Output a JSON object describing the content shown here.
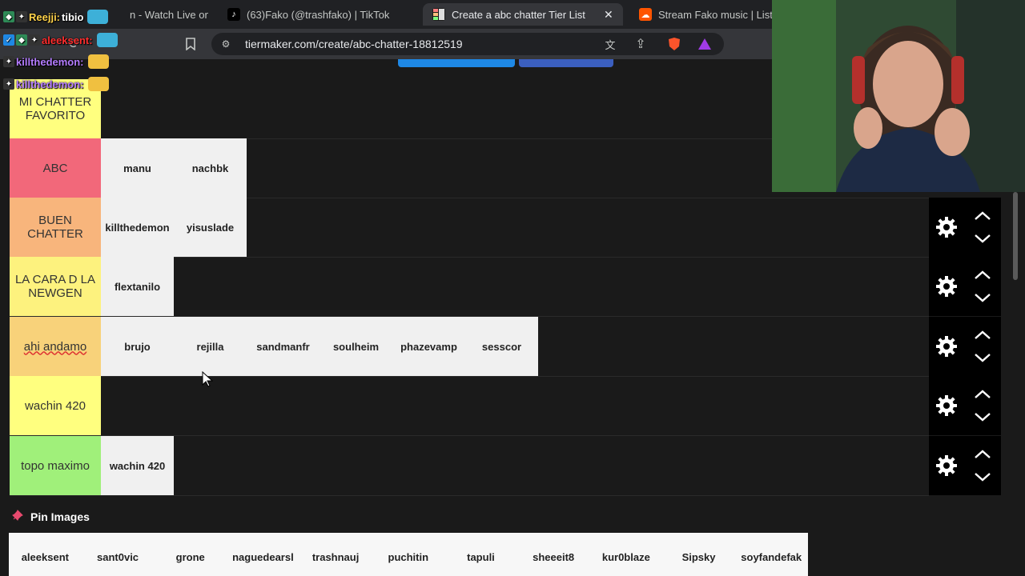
{
  "browser": {
    "tabs": [
      {
        "title": "n - Watch Live on",
        "icon": "twitch-icon"
      },
      {
        "title": "(63)Fako (@trashfako) | TikTok",
        "icon": "tiktok-icon"
      },
      {
        "title": "Create a abc chatter Tier List",
        "icon": "tiermaker-icon",
        "active": true
      },
      {
        "title": "Stream Fako music | List",
        "icon": "soundcloud-icon"
      }
    ],
    "url": "tiermaker.com/create/abc-chatter-18812519",
    "shields_count": "5"
  },
  "tiers": [
    {
      "label": "MI CHATTER FAVORITO",
      "color": "#ffff7f",
      "items": []
    },
    {
      "label": "ABC",
      "color": "#f2687a",
      "items": [
        "manu",
        "nachbk"
      ]
    },
    {
      "label": "BUEN CHATTER",
      "color": "#f8b57c",
      "items": [
        "killthedemon",
        "yisuslade"
      ]
    },
    {
      "label": "LA CARA D LA NEWGEN",
      "color": "#fdf27e",
      "items": [
        "flextanilo"
      ]
    },
    {
      "label": "ahi andamo",
      "color": "#f8d27a",
      "items": [
        "brujo",
        "rejilla",
        "sandmanfr",
        "soulheim",
        "phazevamp",
        "sesscor"
      ]
    },
    {
      "label": "wachin 420",
      "color": "#ffff7f",
      "items": []
    },
    {
      "label": "topo maximo",
      "color": "#a0f07a",
      "items": [
        "wachin 420"
      ]
    }
  ],
  "pin": {
    "title": "Pin Images",
    "items": [
      "aleeksent",
      "sant0vic",
      "grone",
      "naguedearsl",
      "trashnauj",
      "puchitin",
      "tapuli",
      "sheeeit8",
      "kur0blaze",
      "Sipsky",
      "soyfandefak"
    ]
  },
  "chat": [
    {
      "user": "Reejji:",
      "message": "tibio",
      "user_color": "#ffd24a"
    },
    {
      "user": "aleeksent:",
      "message": "",
      "user_color": "#ff2d2d"
    },
    {
      "user": "killthedemon:",
      "message": "",
      "user_color": "#b47cff"
    },
    {
      "user": "killthedemon:",
      "message": "",
      "user_color": "#b47cff"
    }
  ]
}
